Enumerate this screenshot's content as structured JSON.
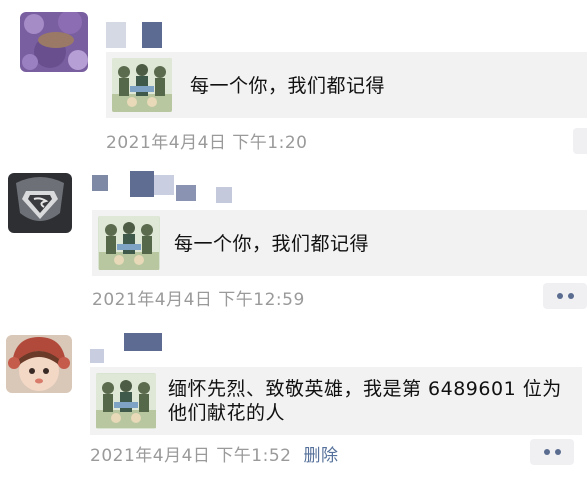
{
  "posts": [
    {
      "share_text": "每一个你，我们都记得",
      "timestamp": "2021年4月4日 下午1:20",
      "avatar_icon": "purple-texture-avatar"
    },
    {
      "share_text": "每一个你，我们都记得",
      "timestamp": "2021年4月4日 下午12:59",
      "avatar_icon": "superman-avatar"
    },
    {
      "share_text": "缅怀先烈、致敬英雄，我是第 6489601 位为他们献花的人",
      "timestamp": "2021年4月4日 下午1:52",
      "delete_label": "删除",
      "avatar_icon": "child-photo-avatar"
    }
  ],
  "colors": {
    "card_bg": "#f2f2f2",
    "timestamp": "#9a9a9a",
    "link": "#55709a",
    "more_dots": "#5a6c8f"
  },
  "icons": {
    "more": "more-dots-icon",
    "share_thumb": "martyr-memorial-thumbnail"
  }
}
